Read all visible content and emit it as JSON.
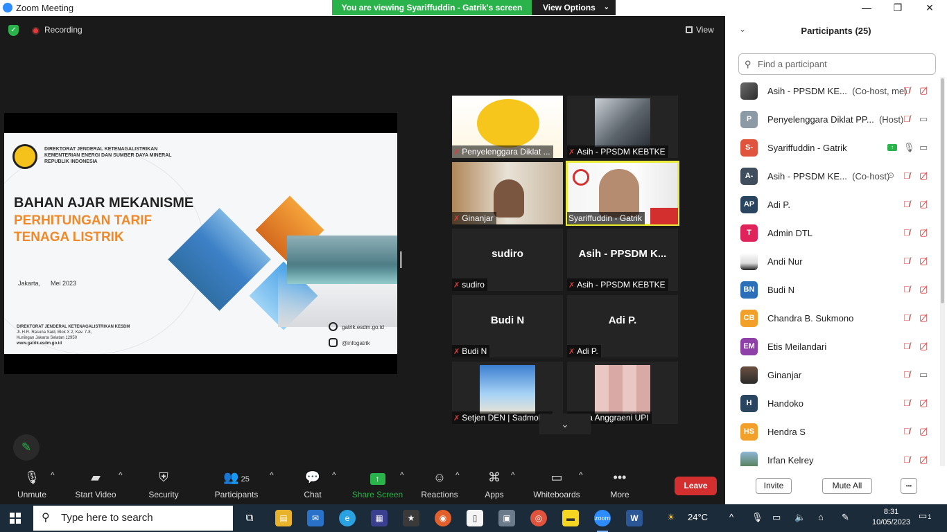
{
  "window": {
    "title": "Zoom Meeting",
    "banner": "You are viewing Syariffuddin - Gatrik's screen",
    "view_options": "View Options",
    "minimize": "—",
    "restore": "❐",
    "close": "✕"
  },
  "meeting": {
    "recording_label": "Recording",
    "view_label": "View"
  },
  "slide": {
    "org_lines": [
      "DIREKTORAT JENDERAL KETENAGALISTRIKAN",
      "KEMENTERIAN ENERGI DAN SUMBER DAYA MINERAL",
      "REPUBLIK INDONESIA"
    ],
    "title_line1": "BAHAN AJAR MEKANISME",
    "title_line2": "PERHITUNGAN TARIF",
    "title_line3": "TENAGA LISTRIK",
    "date": "Jakarta,      Mei 2023",
    "address": [
      "DIREKTORAT JENDERAL KETENAGALISTRIKAN KESDM",
      "Jl. H.R. Rasuna Said, Blok X 2, Kav. 7-8,",
      "Kuningan Jakarta Selatan 12950",
      "www.gatrik.esdm.go.id"
    ],
    "website": "gatrik.esdm.go.id",
    "instagram": "@infogatrik"
  },
  "tiles": [
    {
      "big": "",
      "tag": "Penyelenggara Diklat ..."
    },
    {
      "big": "",
      "tag": "Asih - PPSDM KEBTKE"
    },
    {
      "big": "",
      "tag": "Ginanjar"
    },
    {
      "big": "",
      "tag": "Syariffuddin - Gatrik"
    },
    {
      "big": "sudiro",
      "tag": "sudiro"
    },
    {
      "big": "Asih - PPSDM K...",
      "tag": "Asih - PPSDM KEBTKE"
    },
    {
      "big": "Budi N",
      "tag": "Budi N"
    },
    {
      "big": "Adi P.",
      "tag": "Adi P."
    },
    {
      "big": "",
      "tag": "Setjen DEN | Sadmok..."
    },
    {
      "big": "",
      "tag": "Isna Anggraeni UPI"
    }
  ],
  "toolbar": {
    "unmute": "Unmute",
    "start_video": "Start Video",
    "security": "Security",
    "participants": "Participants",
    "participants_count": "25",
    "chat": "Chat",
    "share_screen": "Share Screen",
    "reactions": "Reactions",
    "apps": "Apps",
    "whiteboards": "Whiteboards",
    "more": "More",
    "leave": "Leave"
  },
  "panel": {
    "title": "Participants (25)",
    "search_placeholder": "Find a participant",
    "participants": [
      {
        "initials": "",
        "color": "",
        "name": "Asih - PPSDM KE...",
        "role": "(Co-host, me)",
        "mic": "muted",
        "cam": "off"
      },
      {
        "initials": "P",
        "color": "#8c9aa6",
        "name": "Penyelenggara Diklat PP...",
        "role": "(Host)",
        "mic": "muted",
        "cam": "on"
      },
      {
        "initials": "S-",
        "color": "#e0533c",
        "name": "Syariffuddin - Gatrik",
        "role": "",
        "mic": "on",
        "cam": "on"
      },
      {
        "initials": "A-",
        "color": "#3f4d5c",
        "name": "Asih - PPSDM KE...",
        "role": "(Co-host)",
        "mic": "muted",
        "cam": "off"
      },
      {
        "initials": "AP",
        "color": "#2a4560",
        "name": "Adi P.",
        "role": "",
        "mic": "muted",
        "cam": "off"
      },
      {
        "initials": "T",
        "color": "#e0235b",
        "name": "Admin DTL",
        "role": "",
        "mic": "muted",
        "cam": "off"
      },
      {
        "initials": "",
        "color": "",
        "name": "Andi Nur",
        "role": "",
        "mic": "muted",
        "cam": "off"
      },
      {
        "initials": "BN",
        "color": "#2a6fb8",
        "name": "Budi N",
        "role": "",
        "mic": "muted",
        "cam": "off"
      },
      {
        "initials": "CB",
        "color": "#f2a02a",
        "name": "Chandra B. Sukmono",
        "role": "",
        "mic": "muted",
        "cam": "off"
      },
      {
        "initials": "EM",
        "color": "#8e3fa8",
        "name": "Etis Meilandari",
        "role": "",
        "mic": "muted",
        "cam": "off"
      },
      {
        "initials": "",
        "color": "",
        "name": "Ginanjar",
        "role": "",
        "mic": "muted",
        "cam": "on"
      },
      {
        "initials": "H",
        "color": "#2a4560",
        "name": "Handoko",
        "role": "",
        "mic": "muted",
        "cam": "off"
      },
      {
        "initials": "HS",
        "color": "#f2a02a",
        "name": "Hendra S",
        "role": "",
        "mic": "muted",
        "cam": "off"
      },
      {
        "initials": "",
        "color": "",
        "name": "Irfan Kelrey",
        "role": "",
        "mic": "muted",
        "cam": "off"
      }
    ],
    "invite": "Invite",
    "mute_all": "Mute All",
    "more": "•••"
  },
  "taskbar": {
    "search_placeholder": "Type here to search",
    "weather": "24°C",
    "time": "8:31",
    "date": "10/05/2023",
    "notifications": "1"
  }
}
